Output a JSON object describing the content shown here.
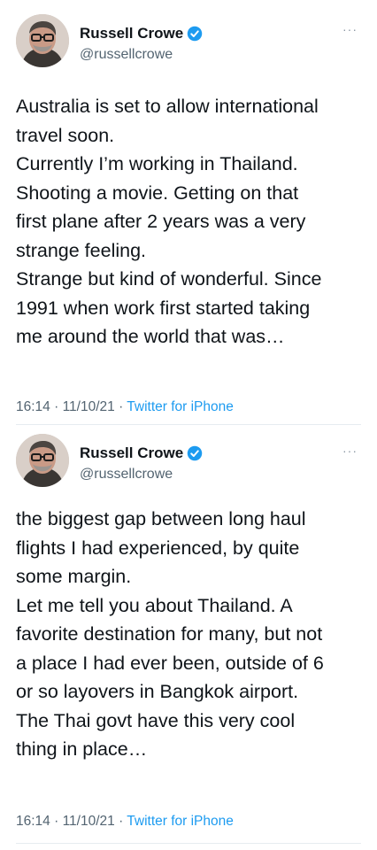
{
  "tweets": [
    {
      "author": {
        "name": "Russell Crowe",
        "handle": "@russellcrowe",
        "verified": true
      },
      "more_label": "···",
      "lines": [
        "Australia is set to allow international",
        "travel soon.",
        "Currently I’m working in Thailand.",
        "Shooting a movie. Getting on that",
        "first plane after 2 years was a very",
        "strange feeling.",
        "Strange but kind of wonderful. Since",
        "1991 when work first started taking",
        "me around the world that was…"
      ],
      "time": "16:14",
      "date": "11/10/21",
      "separator": " · ",
      "source": "Twitter for iPhone"
    },
    {
      "author": {
        "name": "Russell Crowe",
        "handle": "@russellcrowe",
        "verified": true
      },
      "more_label": "···",
      "lines": [
        "the biggest gap between long haul",
        "flights I had experienced, by quite",
        "some margin.",
        "Let me tell you about Thailand. A",
        "favorite destination for many, but not",
        "a place I had ever been, outside of 6",
        "or so layovers in Bangkok airport.",
        "The Thai govt have this very cool",
        "thing in place…"
      ],
      "time": "16:14",
      "date": "11/10/21",
      "separator": " · ",
      "source": "Twitter for iPhone"
    }
  ],
  "colors": {
    "text": "#0f1419",
    "secondary": "#536471",
    "accent": "#1d9bf0",
    "divider": "#e6ecf0"
  }
}
